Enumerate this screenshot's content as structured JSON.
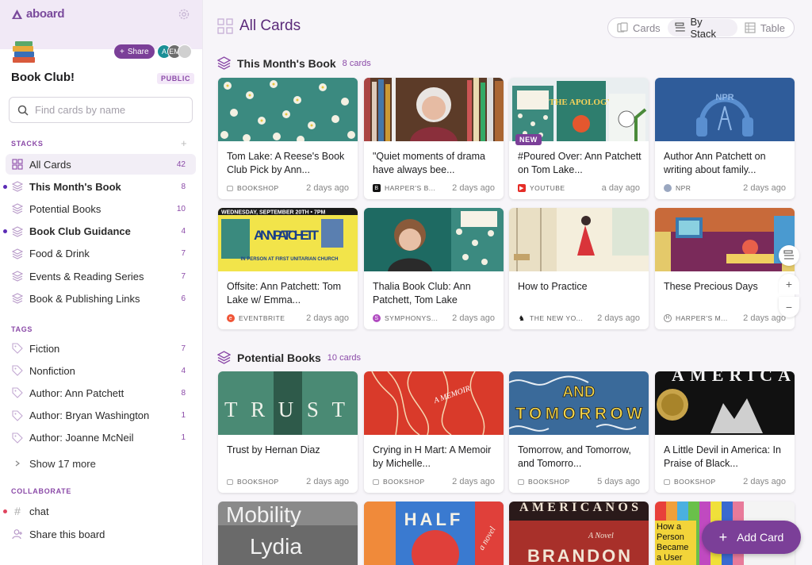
{
  "app": {
    "brand": "aboard"
  },
  "board": {
    "title": "Book Club!",
    "visibility": "PUBLIC",
    "share_label": "Share",
    "members": [
      {
        "initials": "A",
        "color": "#1a8f96"
      },
      {
        "initials": "EM",
        "color": "#6d6d6d"
      },
      {
        "initials": "",
        "color": "#d0d0d0"
      }
    ]
  },
  "search": {
    "placeholder": "Find cards by name"
  },
  "stacks_section": {
    "heading": "STACKS",
    "items": [
      {
        "label": "All Cards",
        "count": "42",
        "icon": "grid-icon"
      },
      {
        "label": "This Month's Book",
        "count": "8",
        "icon": "stack-icon"
      },
      {
        "label": "Potential Books",
        "count": "10",
        "icon": "stack-icon"
      },
      {
        "label": "Book Club Guidance",
        "count": "4",
        "icon": "stack-icon"
      },
      {
        "label": "Food & Drink",
        "count": "7",
        "icon": "stack-icon"
      },
      {
        "label": "Events & Reading Series",
        "count": "7",
        "icon": "stack-icon"
      },
      {
        "label": "Book & Publishing Links",
        "count": "6",
        "icon": "stack-icon"
      }
    ]
  },
  "tags_section": {
    "heading": "TAGS",
    "items": [
      {
        "label": "Fiction",
        "count": "7"
      },
      {
        "label": "Nonfiction",
        "count": "4"
      },
      {
        "label": "Author: Ann Patchett",
        "count": "8"
      },
      {
        "label": "Author: Bryan Washington",
        "count": "1"
      },
      {
        "label": "Author: Joanne McNeil",
        "count": "1"
      }
    ],
    "show_more": "Show 17 more"
  },
  "collaborate_section": {
    "heading": "COLLABORATE",
    "chat": "chat",
    "share_board": "Share this board"
  },
  "main": {
    "title": "All Cards",
    "views": [
      "Cards",
      "By Stack",
      "Table"
    ],
    "active_view": "By Stack",
    "add_card": "Add Card"
  },
  "stacks": [
    {
      "name": "This Month's Book",
      "count_label": "8 cards",
      "cards": [
        {
          "title": "Tom Lake: A Reese's Book Club Pick by Ann...",
          "source": "BOOKSHOP",
          "time": "2 days ago"
        },
        {
          "title": "\"Quiet moments of drama have always bee...",
          "source": "HARPER'S B...",
          "time": "2 days ago"
        },
        {
          "title": "#Poured Over: Ann Patchett on Tom Lake...",
          "source": "YOUTUBE",
          "time": "a day ago",
          "badge": "NEW"
        },
        {
          "title": "Author Ann Patchett on writing about family...",
          "source": "NPR",
          "time": "2 days ago"
        },
        {
          "title": "Offsite: Ann Patchett: Tom Lake w/ Emma...",
          "source": "EVENTBRITE",
          "time": "2 days ago"
        },
        {
          "title": "Thalia Book Club: Ann Patchett, Tom Lake",
          "source": "SYMPHONYS...",
          "time": "2 days ago"
        },
        {
          "title": "How to Practice",
          "source": "THE NEW YO...",
          "time": "2 days ago"
        },
        {
          "title": "These Precious Days",
          "source": "HARPER'S M...",
          "time": "2 days ago"
        }
      ]
    },
    {
      "name": "Potential Books",
      "count_label": "10 cards",
      "cards": [
        {
          "title": "Trust by Hernan Diaz",
          "source": "BOOKSHOP",
          "time": "2 days ago"
        },
        {
          "title": "Crying in H Mart: A Memoir by Michelle...",
          "source": "BOOKSHOP",
          "time": "2 days ago"
        },
        {
          "title": "Tomorrow, and Tomorrow, and Tomorro...",
          "source": "BOOKSHOP",
          "time": "5 days ago"
        },
        {
          "title": "A Little Devil in America: In Praise of Black...",
          "source": "BOOKSHOP",
          "time": "2 days ago"
        }
      ]
    }
  ],
  "image_text": {
    "poster_date": "WEDNESDAY, SEPTEMBER 20TH • 7PM",
    "poster_name": "ANN PATCHETT",
    "poster_sub": "IN PERSON AT FIRST UNITARIAN CHURCH",
    "npr": "NPR",
    "apology": "THE APOLOGY",
    "trust": "TRUST",
    "memoir": "A MEMOIR",
    "and": "AND",
    "tomorrow": "TOMORROW",
    "america": "AMERICA",
    "mobility": "Mobility",
    "lydia": "Lydia",
    "half": "HALF",
    "a_novel": "a novel",
    "americanos": "AMERICANOS",
    "brandon": "BRANDON",
    "a_novel2": "A Novel",
    "how_a_person": "How a Person Became a User"
  }
}
